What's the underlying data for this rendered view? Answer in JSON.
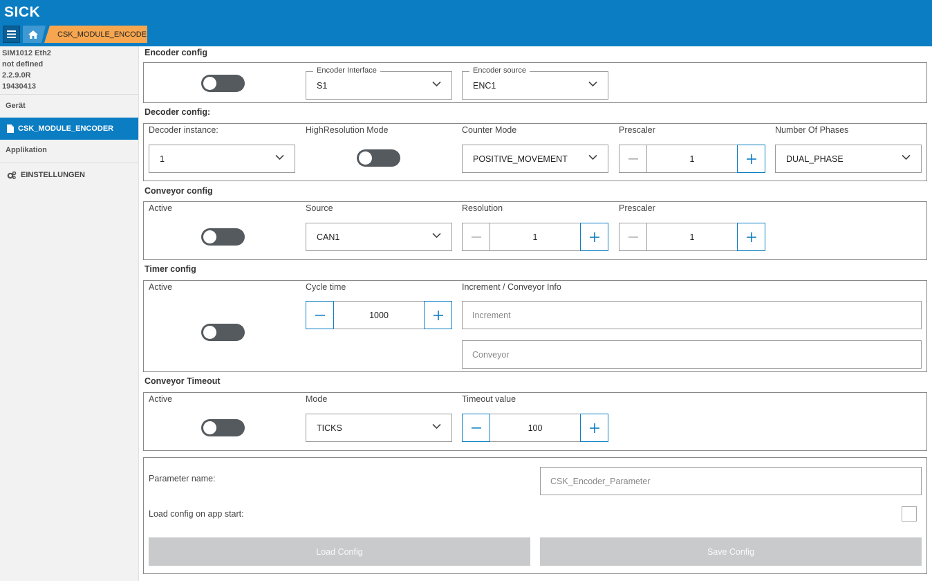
{
  "header": {
    "logo": "SICK",
    "breadcrumb": "CSK_MODULE_ENCODER"
  },
  "sidebar": {
    "device_info": [
      "SIM1012 Eth2",
      "not defined",
      "2.2.9.0R",
      "19430413"
    ],
    "group_device": "Gerät",
    "item_module": "CSK_MODULE_ENCODER",
    "group_app": "Applikation",
    "item_settings": "EINSTELLUNGEN"
  },
  "encoder_config": {
    "title": "Encoder config",
    "interface_label": "Encoder Interface",
    "interface_value": "S1",
    "source_label": "Encoder source",
    "source_value": "ENC1"
  },
  "decoder_config": {
    "title": "Decoder config:",
    "instance_label": "Decoder instance:",
    "instance_value": "1",
    "highres_label": "HighResolution Mode",
    "counter_label": "Counter Mode",
    "counter_value": "POSITIVE_MOVEMENT",
    "prescaler_label": "Prescaler",
    "prescaler_value": "1",
    "phases_label": "Number Of Phases",
    "phases_value": "DUAL_PHASE"
  },
  "conveyor_config": {
    "title": "Conveyor config",
    "active_label": "Active",
    "source_label": "Source",
    "source_value": "CAN1",
    "resolution_label": "Resolution",
    "resolution_value": "1",
    "prescaler_label": "Prescaler",
    "prescaler_value": "1"
  },
  "timer_config": {
    "title": "Timer config",
    "active_label": "Active",
    "cycle_label": "Cycle time",
    "cycle_value": "1000",
    "info_label": "Increment / Conveyor Info",
    "increment_placeholder": "Increment",
    "conveyor_placeholder": "Conveyor"
  },
  "conveyor_timeout": {
    "title": "Conveyor Timeout",
    "active_label": "Active",
    "mode_label": "Mode",
    "mode_value": "TICKS",
    "timeout_label": "Timeout value",
    "timeout_value": "100"
  },
  "parameters": {
    "name_label": "Parameter name:",
    "name_placeholder": "CSK_Encoder_Parameter",
    "load_start_label": "Load config on app start:",
    "load_button": "Load Config",
    "save_button": "Save Config"
  },
  "colors": {
    "header_blue": "#0a7dc3",
    "breadcrumb_orange": "#f7a650",
    "toggle_off": "#555a5e",
    "disabled_button": "#c9cacc"
  }
}
